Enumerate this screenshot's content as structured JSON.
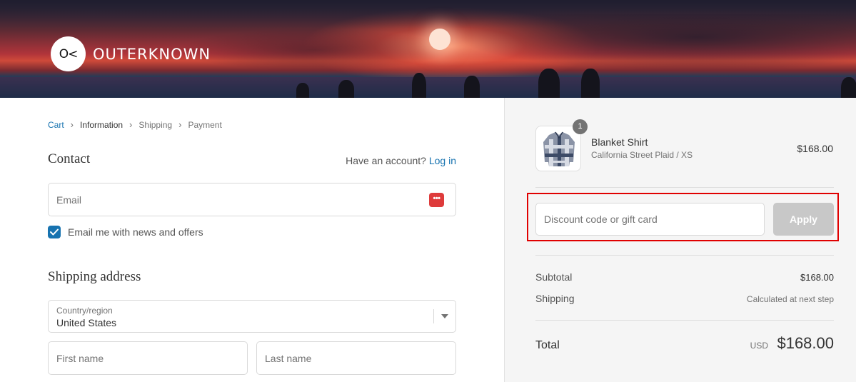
{
  "brand": {
    "logo_mark": "O<",
    "logo_text": "OUTERKNOWN"
  },
  "breadcrumb": [
    {
      "label": "Cart"
    },
    {
      "label": "Information"
    },
    {
      "label": "Shipping"
    },
    {
      "label": "Payment"
    }
  ],
  "contact": {
    "title": "Contact",
    "account_prompt": "Have an account?",
    "login_label": "Log in",
    "email_placeholder": "Email",
    "newsletter_label": "Email me with news and offers",
    "newsletter_checked": true
  },
  "shipping_address": {
    "title": "Shipping address",
    "country_label": "Country/region",
    "country_value": "United States",
    "first_name_placeholder": "First name",
    "last_name_placeholder": "Last name"
  },
  "order": {
    "item": {
      "quantity": "1",
      "name": "Blanket Shirt",
      "variant": "California Street Plaid / XS",
      "price": "$168.00"
    },
    "discount_placeholder": "Discount code or gift card",
    "apply_label": "Apply",
    "subtotal_label": "Subtotal",
    "subtotal_value": "$168.00",
    "shipping_label": "Shipping",
    "shipping_value": "Calculated at next step",
    "total_label": "Total",
    "currency": "USD",
    "total_value": "$168.00"
  },
  "colors": {
    "link": "#1773b0",
    "highlight": "#e00000",
    "apply_button": "#c8c8c8",
    "password_manager_icon": "#de3b3b"
  }
}
